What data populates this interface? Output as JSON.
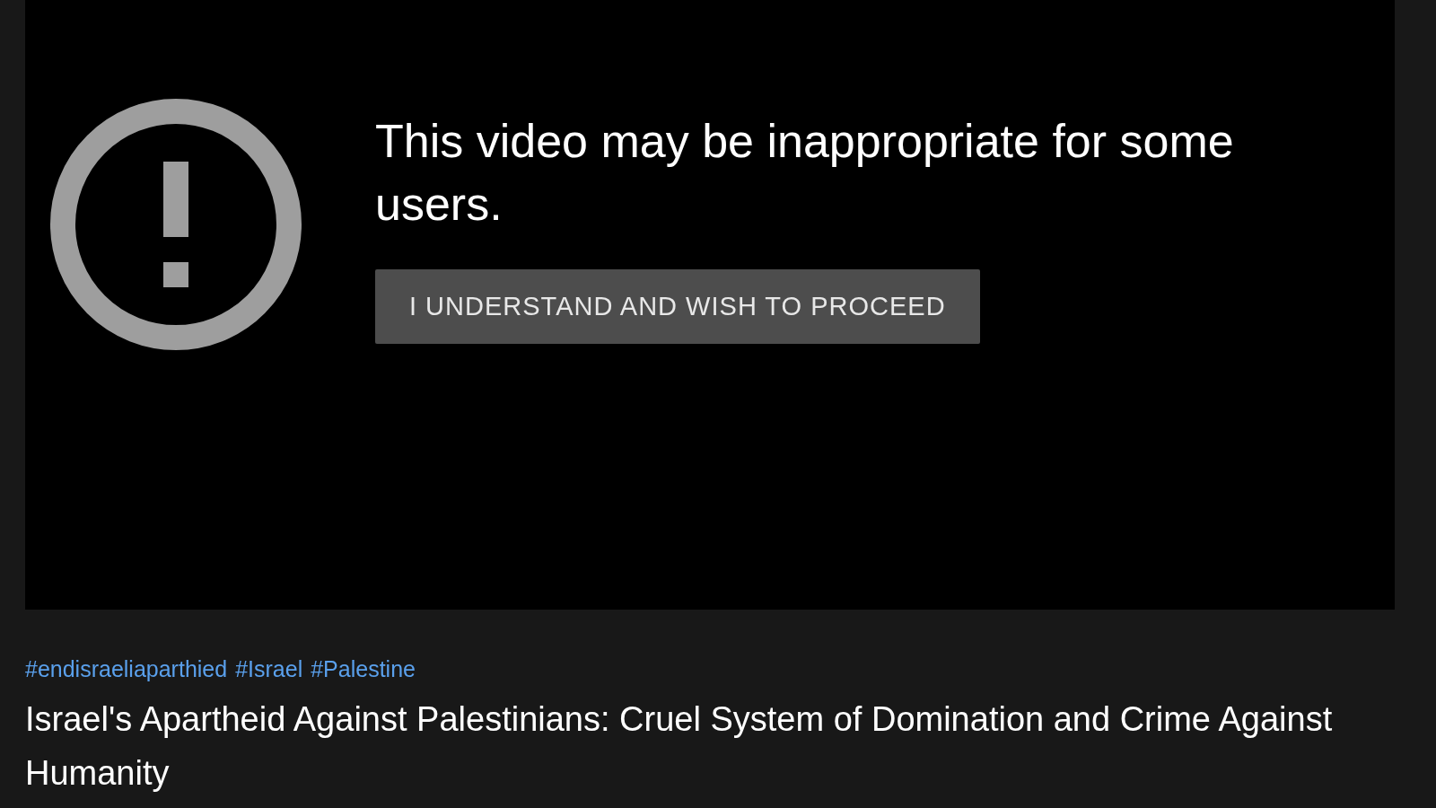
{
  "player": {
    "warning": "This video may be inappropriate for some users.",
    "button": "I UNDERSTAND AND WISH TO PROCEED"
  },
  "hashtags": [
    "#endisraeliaparthied",
    "#Israel",
    "#Palestine"
  ],
  "title": "Israel's Apartheid Against Palestinians: Cruel System of Domination and Crime Against Humanity"
}
